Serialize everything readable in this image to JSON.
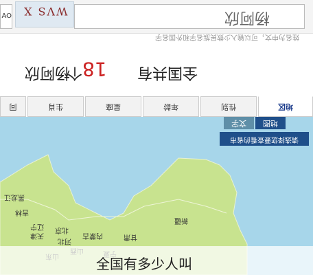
{
  "topbar": {
    "left_input_text": "AO",
    "captcha_text": "WVS X",
    "search_value": "杨阿欣",
    "hint": "姓名为中文，可以输入少数民族名字和外国名字"
  },
  "result": {
    "prefix": "全国共有",
    "count": "18",
    "suffix": "个",
    "name": "杨阿欣"
  },
  "tabs": [
    {
      "label": "地区"
    },
    {
      "label": "性别"
    },
    {
      "label": "年龄"
    },
    {
      "label": "星座"
    },
    {
      "label": "生肖"
    },
    {
      "label": "同"
    }
  ],
  "map": {
    "tabs": [
      "地图",
      "文字"
    ],
    "tip": "请选择您要查看的省市",
    "provinces": [
      "黑龙江",
      "吉林",
      "辽宁",
      "北京",
      "河北",
      "天津",
      "山西",
      "内蒙古",
      "甘肃",
      "新疆",
      "山东",
      "宁夏"
    ]
  },
  "overlay": {
    "caption": "全国有多少人叫"
  }
}
